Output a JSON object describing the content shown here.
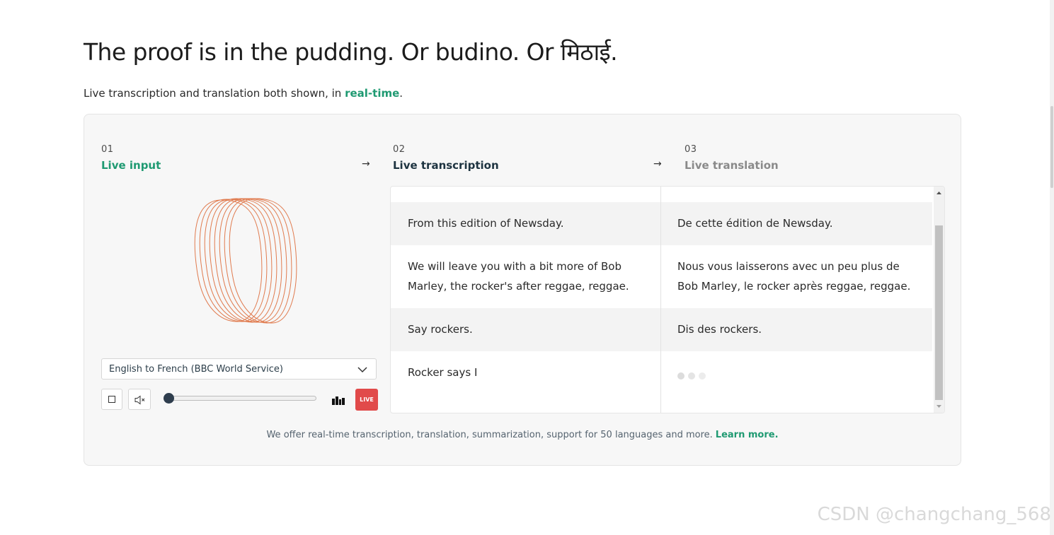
{
  "headline": "The proof is in the pudding. Or budino. Or मिठाई.",
  "subtitle": {
    "prefix": "Live transcription and translation both shown, in ",
    "highlight": "real-time",
    "suffix": "."
  },
  "steps": [
    {
      "num": "01",
      "label": "Live input"
    },
    {
      "num": "02",
      "label": "Live transcription"
    },
    {
      "num": "03",
      "label": "Live translation"
    }
  ],
  "controls": {
    "language_select": "English to French (BBC World Service)",
    "volume_level": 0.0,
    "live_label": "LIVE"
  },
  "rows": [
    {
      "source": "From this edition of Newsday.",
      "target": "De cette édition de Newsday."
    },
    {
      "source": "We will leave you with a bit more of Bob Marley, the rocker's after reggae, reggae.",
      "target": "Nous vous laisserons avec un peu plus de Bob Marley, le rocker après reggae, reggae."
    },
    {
      "source": "Say rockers.",
      "target": "Dis des rockers."
    },
    {
      "source": "Rocker says I",
      "target": ""
    }
  ],
  "footer": {
    "text": "We offer real-time transcription, translation, summarization, support for 50 languages and more.",
    "link": "Learn more."
  },
  "watermark": "CSDN @changchang_568",
  "colors": {
    "accent_green": "#1f9a72",
    "live_red": "#e14a4a",
    "viz_orange": "#e07b4f",
    "navy": "#1d3340"
  },
  "icons": {
    "arrow": "arrow-right-icon",
    "chevron": "chevron-down-icon",
    "stop": "stop-icon",
    "mute": "mute-icon",
    "bars": "bars-icon",
    "viz": "waveform-visualizer",
    "loading": "loading-dots-icon"
  }
}
